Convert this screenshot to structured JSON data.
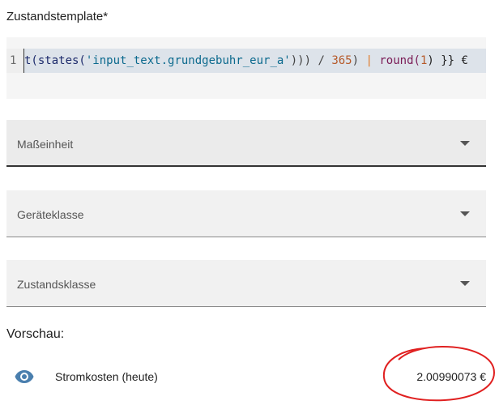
{
  "template_field": {
    "label": "Zustandstemplate*",
    "line_number": "1",
    "code": {
      "part1": "t(",
      "part2": "states(",
      "part3": "'input_text.grundgebuhr_eur_a'",
      "part4": "))) / ",
      "part5": "365",
      "part6": ") ",
      "part7": "|",
      "part8": " round(",
      "part9": "1",
      "part10": ") }} €"
    }
  },
  "selects": [
    {
      "label": "Maßeinheit"
    },
    {
      "label": "Geräteklasse"
    },
    {
      "label": "Zustandsklasse"
    }
  ],
  "preview": {
    "label": "Vorschau:",
    "entity_icon": "eye-icon",
    "entity_name": "Stromkosten (heute)",
    "entity_state": "2.00990073 €"
  },
  "colors": {
    "accent_icon": "#4a7fae",
    "annotation": "#e02020"
  }
}
